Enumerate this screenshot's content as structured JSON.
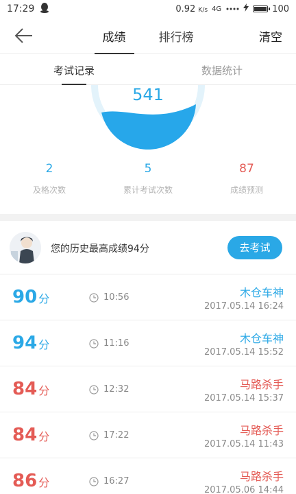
{
  "status_bar": {
    "time": "17:29",
    "speed": "0.92",
    "speed_unit": "K/s",
    "network": "4G",
    "battery": "100"
  },
  "top_nav": {
    "tabs": [
      {
        "label": "成绩",
        "active": true
      },
      {
        "label": "排行榜",
        "active": false
      }
    ],
    "clear_label": "清空"
  },
  "sub_tabs": [
    {
      "label": "考试记录",
      "active": true
    },
    {
      "label": "数据统计",
      "active": false
    }
  ],
  "gauge": {
    "score": "541"
  },
  "stats": [
    {
      "value": "2",
      "label": "及格次数",
      "color": "#2aa8e6"
    },
    {
      "value": "5",
      "label": "累计考试次数",
      "color": "#2aa8e6"
    },
    {
      "value": "87",
      "label": "成绩预测",
      "color": "#e45b55"
    }
  ],
  "history": {
    "text": "您的历史最高成绩94分",
    "button_label": "去考试"
  },
  "records": [
    {
      "score": "90",
      "unit": "分",
      "duration": "10:56",
      "title": "木仓车神",
      "date": "2017.05.14  16:24",
      "color": "#2aa8e6"
    },
    {
      "score": "94",
      "unit": "分",
      "duration": "11:16",
      "title": "木仓车神",
      "date": "2017.05.14  15:52",
      "color": "#2aa8e6"
    },
    {
      "score": "84",
      "unit": "分",
      "duration": "12:32",
      "title": "马路杀手",
      "date": "2017.05.14  15:37",
      "color": "#e45b55"
    },
    {
      "score": "84",
      "unit": "分",
      "duration": "17:22",
      "title": "马路杀手",
      "date": "2017.05.14  11:43",
      "color": "#e45b55"
    },
    {
      "score": "86",
      "unit": "分",
      "duration": "16:27",
      "title": "马路杀手",
      "date": "2017.05.06  14:44",
      "color": "#e45b55"
    }
  ],
  "colors": {
    "accent_blue": "#2aa8e6",
    "accent_red": "#e45b55"
  }
}
